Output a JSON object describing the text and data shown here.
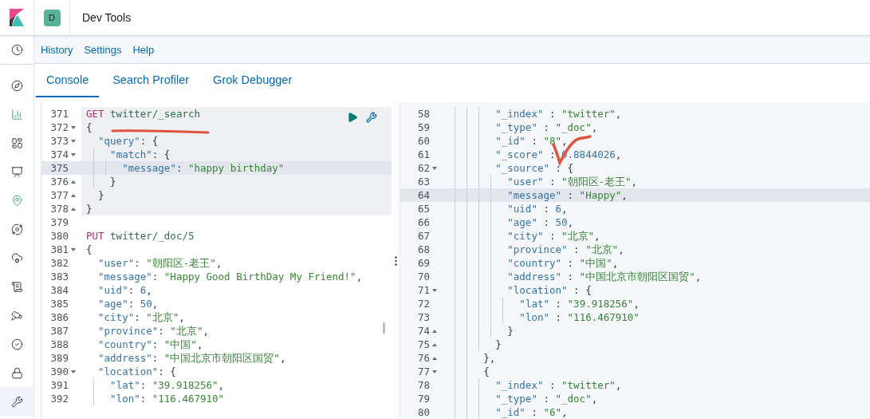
{
  "header": {
    "avatar": "D",
    "title": "Dev Tools"
  },
  "sidebar": {
    "items": [
      {
        "selected": false
      },
      {
        "selected": false
      },
      {
        "selected": false
      },
      {
        "selected": false
      },
      {
        "selected": false
      },
      {
        "selected": false
      },
      {
        "selected": false
      },
      {
        "selected": false
      },
      {
        "selected": false
      },
      {
        "selected": false
      },
      {
        "selected": false
      },
      {
        "selected": false
      },
      {
        "selected": true
      }
    ]
  },
  "menu": [
    "History",
    "Settings",
    "Help"
  ],
  "tabs": [
    {
      "label": "Console",
      "selected": true
    },
    {
      "label": "Search Profiler",
      "selected": false
    },
    {
      "label": "Grok Debugger",
      "selected": false
    }
  ],
  "request_editor": {
    "annotations": [
      {
        "kind": "underline"
      }
    ],
    "lines": [
      {
        "number": "371",
        "kind": "plain",
        "active": false,
        "in_request": true,
        "tokens": [
          {
            "method": "GET"
          },
          {
            "path": "twitter/_search"
          }
        ]
      },
      {
        "number": "372",
        "kind": "fold-start",
        "active": false,
        "in_request": true,
        "tokens": [
          {
            "punct": "{"
          }
        ]
      },
      {
        "number": "373",
        "kind": "fold-start",
        "active": false,
        "in_request": true,
        "tokens": [
          {
            "key": "\"query\""
          },
          {
            "punct": ": {"
          }
        ]
      },
      {
        "number": "374",
        "kind": "fold-start",
        "active": false,
        "in_request": true,
        "tokens": [
          {
            "key": "\"match\""
          },
          {
            "punct": ": {"
          }
        ]
      },
      {
        "number": "375",
        "kind": "plain",
        "active": true,
        "in_request": true,
        "tokens": [
          {
            "key": "\"message\""
          },
          {
            "punct": ":"
          },
          {
            "string": "\"happy birthday\""
          }
        ]
      },
      {
        "number": "376",
        "kind": "fold-end",
        "active": false,
        "in_request": true,
        "tokens": [
          {
            "punct": "}"
          }
        ]
      },
      {
        "number": "377",
        "kind": "fold-end",
        "active": false,
        "in_request": true,
        "tokens": [
          {
            "punct": "}"
          }
        ]
      },
      {
        "number": "378",
        "kind": "fold-end",
        "active": false,
        "in_request": true,
        "tokens": [
          {
            "punct": "}"
          }
        ]
      },
      {
        "number": "379",
        "kind": "plain",
        "active": false,
        "in_request": false
      },
      {
        "number": "380",
        "kind": "plain",
        "active": false,
        "in_request": false,
        "tokens": [
          {
            "method": "PUT"
          },
          {
            "path": "twitter/_doc/5"
          }
        ]
      },
      {
        "number": "381",
        "kind": "fold-start",
        "active": false,
        "in_request": false,
        "tokens": [
          {
            "punct": "{"
          }
        ]
      },
      {
        "number": "382",
        "kind": "plain",
        "active": false,
        "in_request": false,
        "tokens": [
          {
            "key": "\"user\""
          },
          {
            "punct": ":"
          },
          {
            "string": "\"朝阳区-老王\""
          },
          {
            "punct": ","
          }
        ]
      },
      {
        "number": "383",
        "kind": "plain",
        "active": false,
        "in_request": false,
        "tokens": [
          {
            "key": "\"message\""
          },
          {
            "punct": ":"
          },
          {
            "string": "\"Happy Good BirthDay My Friend!\""
          },
          {
            "punct": ","
          }
        ]
      },
      {
        "number": "384",
        "kind": "plain",
        "active": false,
        "in_request": false,
        "tokens": [
          {
            "key": "\"uid\""
          },
          {
            "punct": ":"
          },
          {
            "number": "6"
          },
          {
            "punct": ","
          }
        ]
      },
      {
        "number": "385",
        "kind": "plain",
        "active": false,
        "in_request": false,
        "tokens": [
          {
            "key": "\"age\""
          },
          {
            "punct": ":"
          },
          {
            "number": "50"
          },
          {
            "punct": ","
          }
        ]
      },
      {
        "number": "386",
        "kind": "plain",
        "active": false,
        "in_request": false,
        "tokens": [
          {
            "key": "\"city\""
          },
          {
            "punct": ":"
          },
          {
            "string": "\"北京\""
          },
          {
            "punct": ","
          }
        ]
      },
      {
        "number": "387",
        "kind": "plain",
        "active": false,
        "in_request": false,
        "tokens": [
          {
            "key": "\"province\""
          },
          {
            "punct": ":"
          },
          {
            "string": "\"北京\""
          },
          {
            "punct": ","
          }
        ]
      },
      {
        "number": "388",
        "kind": "plain",
        "active": false,
        "in_request": false,
        "tokens": [
          {
            "key": "\"country\""
          },
          {
            "punct": ":"
          },
          {
            "string": "\"中国\""
          },
          {
            "punct": ","
          }
        ]
      },
      {
        "number": "389",
        "kind": "plain",
        "active": false,
        "in_request": false,
        "tokens": [
          {
            "key": "\"address\""
          },
          {
            "punct": ":"
          },
          {
            "string": "\"中国北京市朝阳区国贸\""
          },
          {
            "punct": ","
          }
        ]
      },
      {
        "number": "390",
        "kind": "fold-start",
        "active": false,
        "in_request": false,
        "tokens": [
          {
            "key": "\"location\""
          },
          {
            "punct": ": {"
          }
        ]
      },
      {
        "number": "391",
        "kind": "plain",
        "active": false,
        "in_request": false,
        "tokens": [
          {
            "key": "\"lat\""
          },
          {
            "punct": ":"
          },
          {
            "string": "\"39.918256\""
          },
          {
            "punct": ","
          }
        ]
      },
      {
        "number": "392",
        "kind": "plain",
        "active": false,
        "in_request": false,
        "tokens": [
          {
            "key": "\"lon\""
          },
          {
            "punct": ":"
          },
          {
            "string": "\"116.467910\""
          }
        ]
      }
    ]
  },
  "response_viewer": {
    "annotations": [
      {
        "kind": "check"
      }
    ],
    "lines": [
      {
        "number": "58",
        "kind": "plain",
        "active": false,
        "tokens": [
          {
            "key": "\"_index\""
          },
          {
            "punct": " :"
          },
          {
            "string": "\"twitter\""
          },
          {
            "punct": ","
          }
        ]
      },
      {
        "number": "59",
        "kind": "plain",
        "active": false,
        "tokens": [
          {
            "key": "\"_type\""
          },
          {
            "punct": " :"
          },
          {
            "string": "\"_doc\""
          },
          {
            "punct": ","
          }
        ]
      },
      {
        "number": "60",
        "kind": "plain",
        "active": false,
        "tokens": [
          {
            "key": "\"_id\""
          },
          {
            "punct": " :"
          },
          {
            "string": "\"8\""
          },
          {
            "punct": ","
          }
        ]
      },
      {
        "number": "61",
        "kind": "plain",
        "active": false,
        "tokens": [
          {
            "key": "\"_score\""
          },
          {
            "punct": " :"
          },
          {
            "number": "0.8844026"
          },
          {
            "punct": ","
          }
        ]
      },
      {
        "number": "62",
        "kind": "fold-start",
        "active": false,
        "tokens": [
          {
            "key": "\"_source\""
          },
          {
            "punct": " : {"
          }
        ]
      },
      {
        "number": "63",
        "kind": "plain",
        "active": false,
        "tokens": [
          {
            "key": "\"user\""
          },
          {
            "punct": " :"
          },
          {
            "string": "\"朝阳区-老王\""
          },
          {
            "punct": ","
          }
        ]
      },
      {
        "number": "64",
        "kind": "plain",
        "active": true,
        "tokens": [
          {
            "key": "\"message\""
          },
          {
            "punct": " :"
          },
          {
            "string": "\"Happy\""
          },
          {
            "punct": ","
          }
        ]
      },
      {
        "number": "65",
        "kind": "plain",
        "active": false,
        "tokens": [
          {
            "key": "\"uid\""
          },
          {
            "punct": " :"
          },
          {
            "number": "6"
          },
          {
            "punct": ","
          }
        ]
      },
      {
        "number": "66",
        "kind": "plain",
        "active": false,
        "tokens": [
          {
            "key": "\"age\""
          },
          {
            "punct": " :"
          },
          {
            "number": "50"
          },
          {
            "punct": ","
          }
        ]
      },
      {
        "number": "67",
        "kind": "plain",
        "active": false,
        "tokens": [
          {
            "key": "\"city\""
          },
          {
            "punct": " :"
          },
          {
            "string": "\"北京\""
          },
          {
            "punct": ","
          }
        ]
      },
      {
        "number": "68",
        "kind": "plain",
        "active": false,
        "tokens": [
          {
            "key": "\"province\""
          },
          {
            "punct": " :"
          },
          {
            "string": "\"北京\""
          },
          {
            "punct": ","
          }
        ]
      },
      {
        "number": "69",
        "kind": "plain",
        "active": false,
        "tokens": [
          {
            "key": "\"country\""
          },
          {
            "punct": " :"
          },
          {
            "string": "\"中国\""
          },
          {
            "punct": ","
          }
        ]
      },
      {
        "number": "70",
        "kind": "plain",
        "active": false,
        "tokens": [
          {
            "key": "\"address\""
          },
          {
            "punct": " :"
          },
          {
            "string": "\"中国北京市朝阳区国贸\""
          },
          {
            "punct": ","
          }
        ]
      },
      {
        "number": "71",
        "kind": "fold-start",
        "active": false,
        "tokens": [
          {
            "key": "\"location\""
          },
          {
            "punct": " : {"
          }
        ]
      },
      {
        "number": "72",
        "kind": "plain",
        "active": false,
        "tokens": [
          {
            "key": "\"lat\""
          },
          {
            "punct": " :"
          },
          {
            "string": "\"39.918256\""
          },
          {
            "punct": ","
          }
        ]
      },
      {
        "number": "73",
        "kind": "plain",
        "active": false,
        "tokens": [
          {
            "key": "\"lon\""
          },
          {
            "punct": " :"
          },
          {
            "string": "\"116.467910\""
          }
        ]
      },
      {
        "number": "74",
        "kind": "fold-end",
        "active": false,
        "tokens": [
          {
            "punct": "}"
          }
        ]
      },
      {
        "number": "75",
        "kind": "fold-end",
        "active": false,
        "tokens": [
          {
            "punct": "}"
          }
        ]
      },
      {
        "number": "76",
        "kind": "fold-end",
        "active": false,
        "tokens": [
          {
            "punct": "},"
          }
        ]
      },
      {
        "number": "77",
        "kind": "fold-start",
        "active": false,
        "tokens": [
          {
            "punct": "{"
          }
        ]
      },
      {
        "number": "78",
        "kind": "plain",
        "active": false,
        "tokens": [
          {
            "key": "\"_index\""
          },
          {
            "punct": " :"
          },
          {
            "string": "\"twitter\""
          },
          {
            "punct": ","
          }
        ]
      },
      {
        "number": "79",
        "kind": "plain",
        "active": false,
        "tokens": [
          {
            "key": "\"_type\""
          },
          {
            "punct": " :"
          },
          {
            "string": "\"_doc\""
          },
          {
            "punct": ","
          }
        ]
      },
      {
        "number": "80",
        "kind": "plain",
        "active": false,
        "tokens": [
          {
            "key": "\"_id\""
          },
          {
            "punct": " :"
          },
          {
            "string": "\"6\""
          },
          {
            "punct": ","
          }
        ]
      }
    ]
  }
}
